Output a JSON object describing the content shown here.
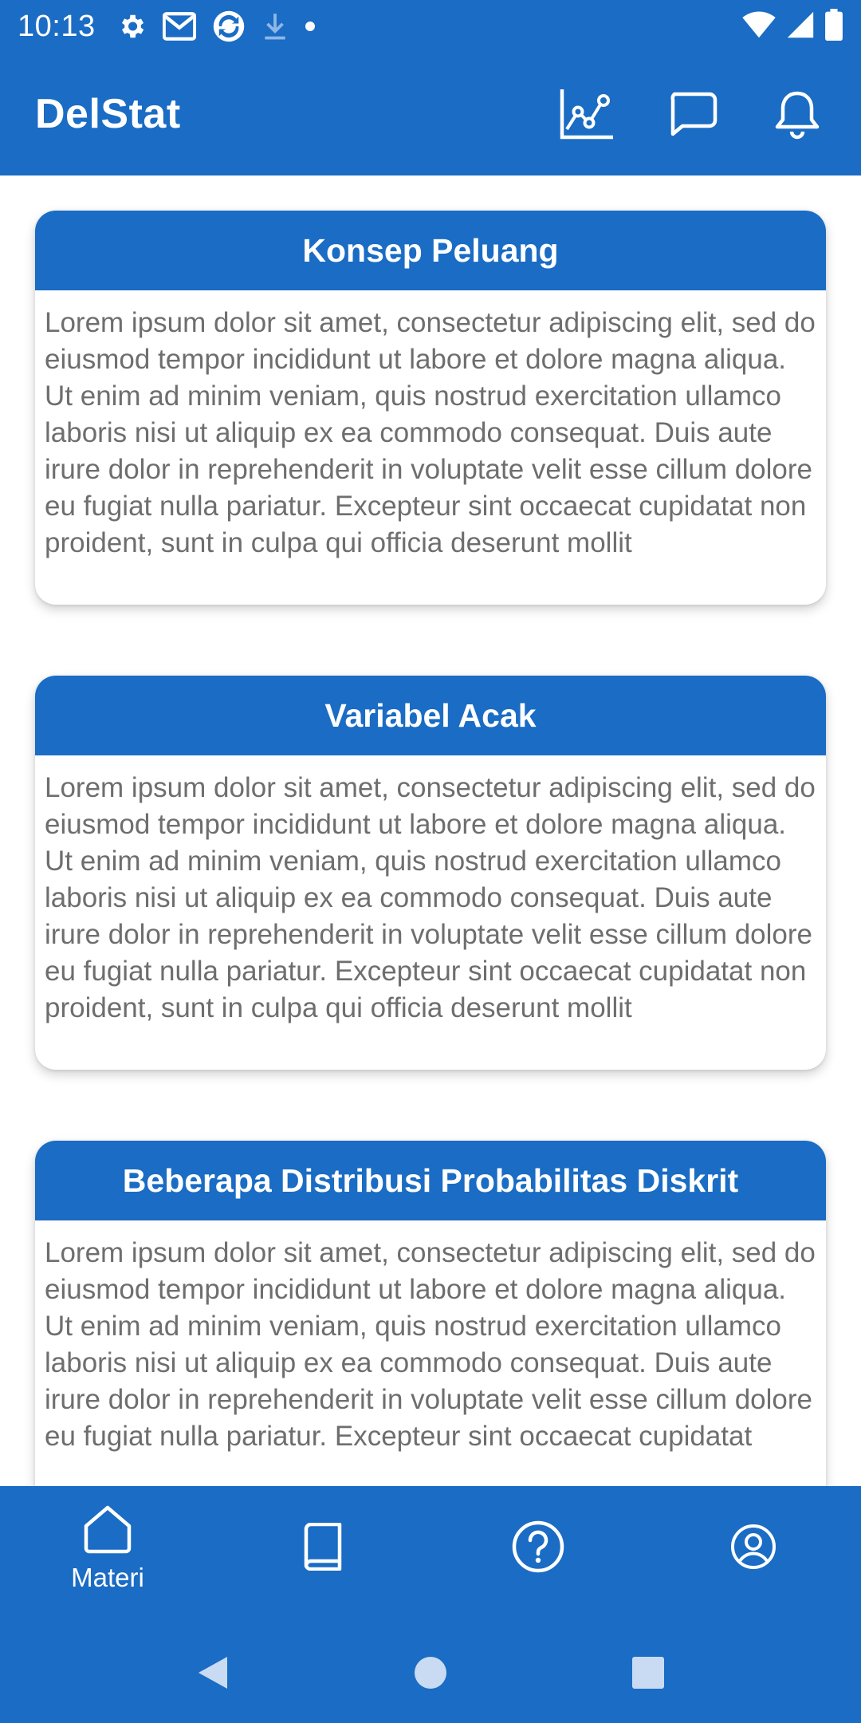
{
  "status_bar": {
    "time": "10:13",
    "icons": [
      "gear-icon",
      "gmail-icon",
      "sync-icon",
      "download-icon",
      "dot-icon"
    ],
    "right_icons": [
      "wifi-icon",
      "signal-icon",
      "battery-icon"
    ]
  },
  "app_bar": {
    "title": "DelStat",
    "actions": [
      "chart-icon",
      "chat-icon",
      "bell-icon"
    ]
  },
  "cards": [
    {
      "title": "Konsep Peluang",
      "body": "Lorem ipsum dolor sit amet, consectetur adipiscing elit, sed do eiusmod tempor incididunt ut labore et dolore magna aliqua. Ut enim ad minim veniam, quis nostrud exercitation ullamco laboris nisi ut aliquip ex ea commodo consequat. Duis aute irure dolor in reprehenderit in voluptate velit esse cillum dolore eu fugiat nulla pariatur. Excepteur sint occaecat cupidatat non proident, sunt in culpa qui officia deserunt mollit"
    },
    {
      "title": "Variabel Acak",
      "body": "Lorem ipsum dolor sit amet, consectetur adipiscing elit, sed do eiusmod tempor incididunt ut labore et dolore magna aliqua. Ut enim ad minim veniam, quis nostrud exercitation ullamco laboris nisi ut aliquip ex ea commodo consequat. Duis aute irure dolor in reprehenderit in voluptate velit esse cillum dolore eu fugiat nulla pariatur. Excepteur sint occaecat cupidatat non proident, sunt in culpa qui officia deserunt mollit"
    },
    {
      "title": "Beberapa Distribusi Probabilitas Diskrit",
      "body": "Lorem ipsum dolor sit amet, consectetur adipiscing elit, sed do eiusmod tempor incididunt ut labore et dolore magna aliqua. Ut enim ad minim veniam, quis nostrud exercitation ullamco laboris nisi ut aliquip ex ea commodo consequat. Duis aute irure dolor in reprehenderit in voluptate velit esse cillum dolore eu fugiat nulla pariatur. Excepteur sint occaecat cupidatat"
    }
  ],
  "bottom_nav": {
    "items": [
      {
        "icon": "home-icon",
        "label": "Materi",
        "active": true
      },
      {
        "icon": "book-icon",
        "label": "",
        "active": false
      },
      {
        "icon": "help-icon",
        "label": "",
        "active": false
      },
      {
        "icon": "profile-icon",
        "label": "",
        "active": false
      }
    ]
  },
  "system_nav": [
    "back-icon",
    "home-circle-icon",
    "recents-icon"
  ],
  "colors": {
    "primary": "#1a6cc4",
    "card_text": "#6e6e6e",
    "background": "#ffffff"
  }
}
